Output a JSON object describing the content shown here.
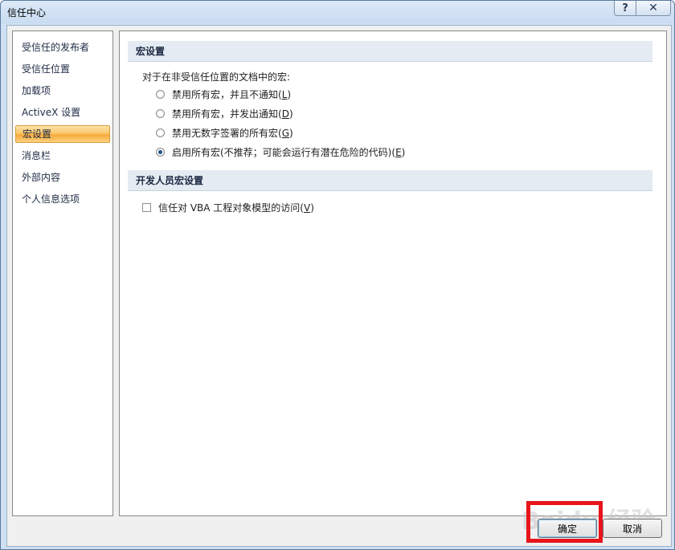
{
  "window": {
    "title": "信任中心"
  },
  "titlebar_buttons": {
    "help": "?",
    "close": "✕"
  },
  "nav": {
    "items": [
      {
        "label": "受信任的发布者",
        "selected": false
      },
      {
        "label": "受信任位置",
        "selected": false
      },
      {
        "label": "加载项",
        "selected": false
      },
      {
        "label": "ActiveX 设置",
        "selected": false
      },
      {
        "label": "宏设置",
        "selected": true
      },
      {
        "label": "消息栏",
        "selected": false
      },
      {
        "label": "外部内容",
        "selected": false
      },
      {
        "label": "个人信息选项",
        "selected": false
      }
    ]
  },
  "macro_section": {
    "header": "宏设置",
    "prompt": "对于在非受信任位置的文档中的宏:",
    "options": [
      {
        "label": "禁用所有宏，并且不通知(",
        "key": "L",
        "suffix": ")",
        "checked": false
      },
      {
        "label": "禁用所有宏，并发出通知(",
        "key": "D",
        "suffix": ")",
        "checked": false
      },
      {
        "label": "禁用无数字签署的所有宏(",
        "key": "G",
        "suffix": ")",
        "checked": false
      },
      {
        "label": "启用所有宏(不推荐；可能会运行有潜在危险的代码)(",
        "key": "E",
        "suffix": ")",
        "checked": true
      }
    ]
  },
  "developer_section": {
    "header": "开发人员宏设置",
    "checkbox": {
      "label": "信任对 VBA 工程对象模型的访问(",
      "key": "V",
      "suffix": ")",
      "checked": false
    }
  },
  "buttons": {
    "ok": "确定",
    "cancel": "取消"
  },
  "watermark": {
    "text": "Baidu 经验"
  },
  "colors": {
    "highlight": "#e8141b",
    "selected_nav": "#fbc76a"
  }
}
